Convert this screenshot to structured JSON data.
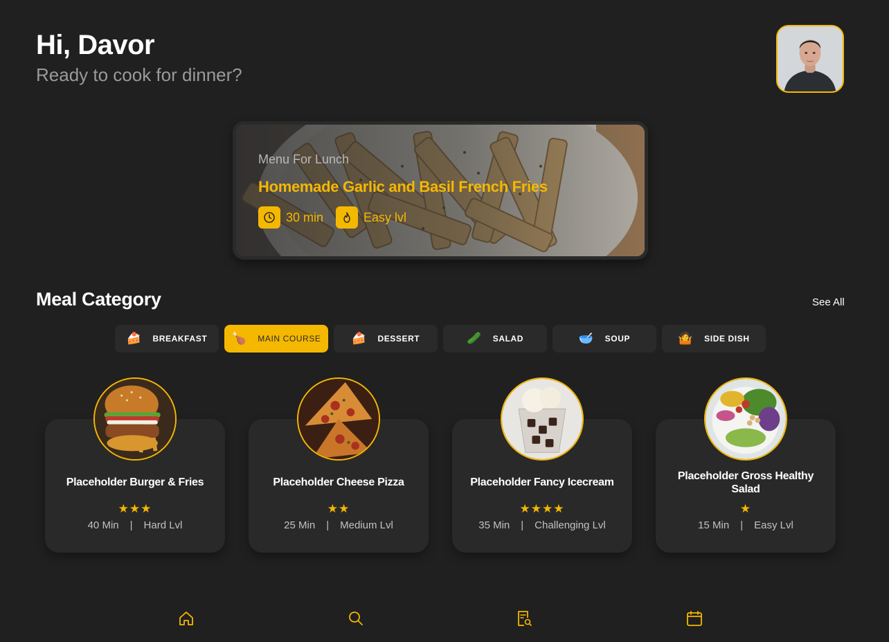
{
  "header": {
    "greeting": "Hi, Davor",
    "subtitle": "Ready to cook for dinner?",
    "avatar_icon": "user-avatar"
  },
  "featured": {
    "label": "Menu For Lunch",
    "title": "Homemade Garlic and Basil French Fries",
    "time": "30 min",
    "time_icon": "clock-icon",
    "level": "Easy lvl",
    "level_icon": "flame-icon"
  },
  "category_section": {
    "title": "Meal Category",
    "see_all": "See All"
  },
  "categories": [
    {
      "label": "BREAKFAST",
      "emoji": "🍰",
      "active": false
    },
    {
      "label": "MAIN COURSE",
      "emoji": "🍗",
      "active": true
    },
    {
      "label": "DESSERT",
      "emoji": "🍰",
      "active": false
    },
    {
      "label": "SALAD",
      "emoji": "🥒",
      "active": false
    },
    {
      "label": "SOUP",
      "emoji": "🥣",
      "active": false
    },
    {
      "label": "SIDE DISH",
      "emoji": "🤷",
      "active": false
    }
  ],
  "meals": [
    {
      "name": "Placeholder Burger & Fries",
      "stars": "★★★",
      "rating": 3,
      "time": "40 Min",
      "sep": "|",
      "level": "Hard Lvl"
    },
    {
      "name": "Placeholder Cheese Pizza",
      "stars": "★★",
      "rating": 2,
      "time": "25 Min",
      "sep": "|",
      "level": "Medium Lvl"
    },
    {
      "name": "Placeholder Fancy Icecream",
      "stars": "★★★★",
      "rating": 4,
      "time": "35 Min",
      "sep": "|",
      "level": "Challenging Lvl"
    },
    {
      "name": "Placeholder Gross Healthy Salad",
      "stars": "★",
      "rating": 1,
      "time": "15 Min",
      "sep": "|",
      "level": "Easy Lvl"
    }
  ],
  "bottom_nav": {
    "items": [
      "home-icon",
      "search-icon",
      "recipe-search-icon",
      "calendar-icon"
    ]
  },
  "colors": {
    "background": "#202020",
    "card": "#292929",
    "accent": "#f5b800",
    "muted": "#9a9a9a"
  }
}
